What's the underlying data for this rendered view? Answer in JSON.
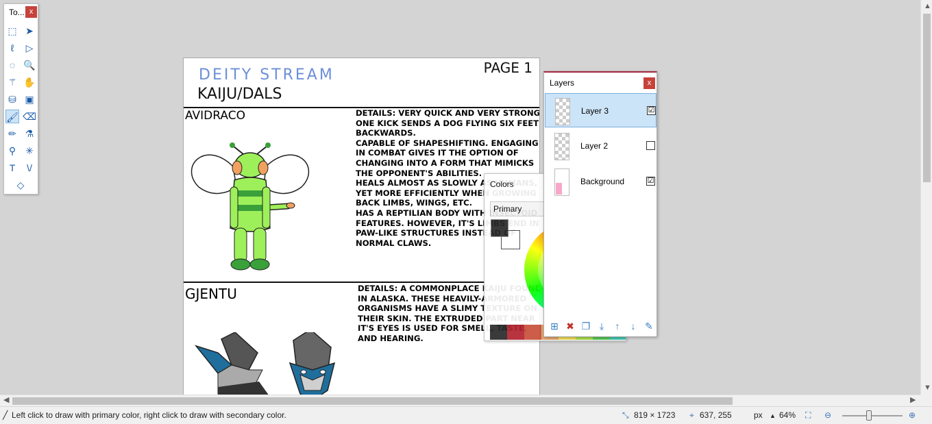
{
  "document": {
    "header_title": "DEITY STREAM",
    "header_subtitle": "KAIJU/DALS",
    "page_label": "PAGE 1",
    "entries": [
      {
        "name": "AVIDRACO",
        "details": [
          "DETAILS: VERY QUICK AND VERY STRONG.",
          "ONE KICK SENDS A DOG FLYING SIX FEET",
          "BACKWARDS.",
          "CAPABLE OF SHAPESHIFTING. ENGAGING",
          "IN COMBAT GIVES IT THE OPTION OF",
          "CHANGING INTO A FORM THAT MIMICKS",
          "THE OPPONENT'S ABILITIES.",
          "HEALS ALMOST AS SLOWLY AS HUMANS,",
          "YET MORE EFFICIENTLY WHEN GROWING",
          "BACK LIMBS, WINGS, ETC.",
          "HAS A REPTILIAN BODY WITH INSECTOID",
          "FEATURES. HOWEVER, IT'S LIMBS END IN",
          "PAW-LIKE STRUCTURES INSTEAD OF",
          "NORMAL CLAWS."
        ]
      },
      {
        "name": "GJENTU",
        "details": [
          "DETAILS: A COMMONPLACE KAIJU FOUND",
          "IN ALASKA. THESE HEAVILY-ARMORED",
          "ORGANISMS HAVE A SLIMY TEXTURE ON",
          "THEIR SKIN. THE EXTRUDED PART NEAR",
          "IT'S EYES IS USED FOR SMELL, TASTE,",
          "AND HEARING."
        ]
      }
    ]
  },
  "tools_window": {
    "title": "To...",
    "close_label": "x",
    "tools": [
      {
        "name": "rectangle-select-icon",
        "glyph": "⬚"
      },
      {
        "name": "move-selected-icon",
        "glyph": "➤"
      },
      {
        "name": "lasso-select-icon",
        "glyph": "ℓ"
      },
      {
        "name": "move-selection-icon",
        "glyph": "▷"
      },
      {
        "name": "ellipse-select-icon",
        "glyph": "◌"
      },
      {
        "name": "zoom-icon",
        "glyph": "🔍"
      },
      {
        "name": "magic-wand-icon",
        "glyph": "⚚"
      },
      {
        "name": "pan-icon",
        "glyph": "✋"
      },
      {
        "name": "paint-bucket-icon",
        "glyph": "⛁"
      },
      {
        "name": "gradient-icon",
        "glyph": "▣"
      },
      {
        "name": "paintbrush-icon",
        "glyph": "🖌"
      },
      {
        "name": "eraser-icon",
        "glyph": "⌫"
      },
      {
        "name": "pencil-icon",
        "glyph": "✏"
      },
      {
        "name": "color-picker-icon",
        "glyph": "⚗"
      },
      {
        "name": "clone-stamp-icon",
        "glyph": "⚲"
      },
      {
        "name": "recolor-icon",
        "glyph": "✳"
      },
      {
        "name": "text-icon",
        "glyph": "T"
      },
      {
        "name": "line-curve-icon",
        "glyph": "\\/"
      },
      {
        "name": "shapes-icon",
        "glyph": "◇"
      }
    ],
    "selected_tool": "paintbrush-icon"
  },
  "colors_window": {
    "title": "Colors",
    "mode": "Primary",
    "primary_color": "#2a2a2a",
    "secondary_color": "#ffffff",
    "palette": [
      "#2a2a2a",
      "#b2232e",
      "#c8503a",
      "#e6a066",
      "#f2dd4c",
      "#a6de3c",
      "#4cc84c",
      "#38c8b0"
    ]
  },
  "layers_window": {
    "title": "Layers",
    "close_label": "x",
    "layers": [
      {
        "name": "Layer 3",
        "visible": "☑",
        "selected": true
      },
      {
        "name": "Layer 2",
        "visible": "",
        "selected": false
      },
      {
        "name": "Background",
        "visible": "☑",
        "selected": false
      }
    ],
    "toolbar": [
      {
        "name": "add-layer-icon",
        "glyph": "⊞"
      },
      {
        "name": "delete-layer-icon",
        "glyph": "✖"
      },
      {
        "name": "duplicate-layer-icon",
        "glyph": "❐"
      },
      {
        "name": "merge-layer-down-icon",
        "glyph": "⤓"
      },
      {
        "name": "move-layer-up-icon",
        "glyph": "↑"
      },
      {
        "name": "move-layer-down-icon",
        "glyph": "↓"
      },
      {
        "name": "layer-properties-icon",
        "glyph": "✎"
      }
    ]
  },
  "status_bar": {
    "hint": "Left click to draw with primary color, right click to draw with secondary color.",
    "image_size": "819 × 1723",
    "cursor_position": "637, 255",
    "units": "px",
    "zoom": "64%"
  }
}
